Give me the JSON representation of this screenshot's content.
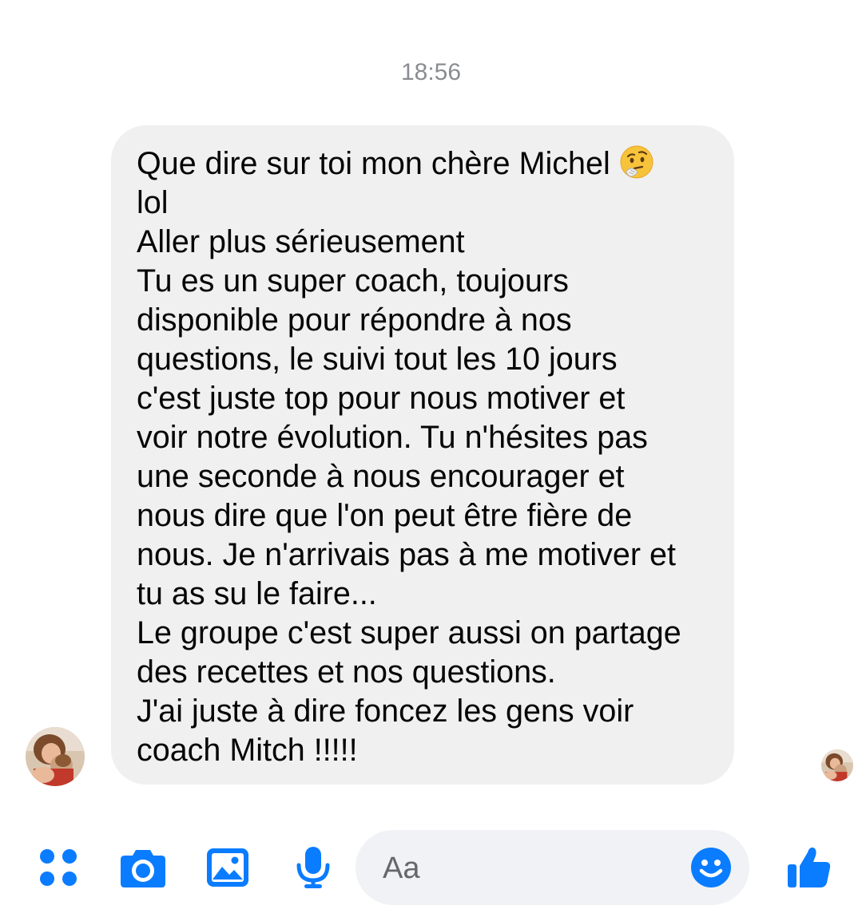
{
  "conversation": {
    "timestamp": "18:56",
    "message": {
      "lines": [
        "Que dire sur toi mon chère Michel",
        "lol",
        "Aller plus sérieusement",
        "Tu es un super coach, toujours",
        "disponible pour répondre à nos",
        "questions, le suivi tout les 10 jours",
        "c'est juste top pour nous motiver et",
        "voir notre évolution. Tu n'hésites pas",
        "une seconde à nous encourager et",
        "nous dire que l'on peut être fière de",
        "nous. Je n'arrivais pas à me motiver et",
        "tu as su le faire...",
        "Le groupe c'est super aussi on partage",
        "des recettes et nos questions.",
        "J'ai juste à dire foncez les gens voir",
        "coach Mitch !!!!!"
      ],
      "emoji": "thinking-face-emoji"
    }
  },
  "composer": {
    "placeholder": "Aa"
  },
  "icons": {
    "menu": "four-dots-icon",
    "camera": "camera-icon",
    "gallery": "image-icon",
    "voice": "microphone-icon",
    "emoji": "smiley-icon",
    "like": "thumbs-up-icon"
  },
  "colors": {
    "accent": "#0a7cff",
    "bubble": "#f0f0f1",
    "timestamp": "#8a8d91"
  }
}
